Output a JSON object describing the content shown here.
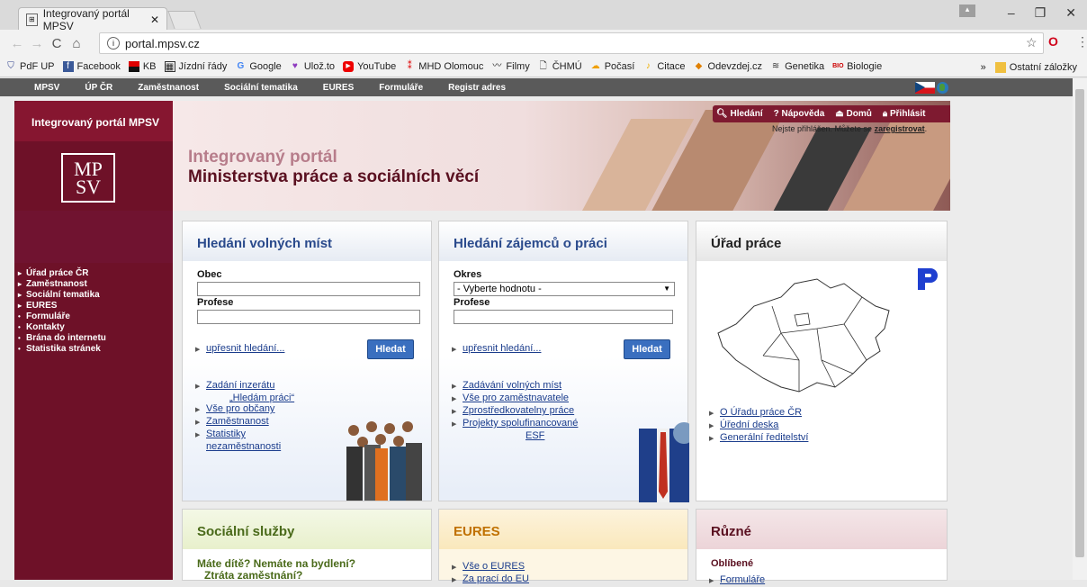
{
  "browser": {
    "tab_title": "Integrovaný portál MPSV",
    "url": "portal.mpsv.cz",
    "bookmarks": [
      "PdF UP",
      "Facebook",
      "KB",
      "Jízdní řády",
      "Google",
      "Ulož.to",
      "YouTube",
      "MHD Olomouc",
      "Filmy",
      "ČHMÚ",
      "Počasí",
      "Citace",
      "Odevzdej.cz",
      "Genetika",
      "Biologie"
    ],
    "other_bookmarks": "Ostatní záložky",
    "chevron": "»"
  },
  "topnav": [
    "MPSV",
    "ÚP ČR",
    "Zaměstnanost",
    "Sociální tematika",
    "EURES",
    "Formuláře",
    "Registr adres"
  ],
  "left": {
    "title": "Integrovaný portál MPSV",
    "logo_top": "MP",
    "logo_bottom": "SV",
    "nav": [
      {
        "bullet": "▸",
        "label": "Úřad práce ČR"
      },
      {
        "bullet": "▸",
        "label": "Zaměstnanost"
      },
      {
        "bullet": "▸",
        "label": "Sociální tematika"
      },
      {
        "bullet": "▸",
        "label": "EURES"
      },
      {
        "bullet": "•",
        "label": "Formuláře"
      },
      {
        "bullet": "•",
        "label": "Kontakty"
      },
      {
        "bullet": "•",
        "label": "Brána do internetu"
      },
      {
        "bullet": "•",
        "label": "Statistika stránek"
      }
    ]
  },
  "banner": {
    "line1": "Integrovaný portál",
    "line2": "Ministerstva práce a sociálních věcí",
    "util": [
      "Hledání",
      "Nápověda",
      "Domů",
      "Přihlásit"
    ],
    "login_msg": "Nejste přihlášen. Můžete se",
    "register": "zaregistrovat"
  },
  "box1": {
    "title": "Hledání volných míst",
    "obec": "Obec",
    "profese": "Profese",
    "refine": "upřesnit hledání...",
    "search": "Hledat",
    "links": [
      "Zadání inzerátu",
      "„Hledám práci“",
      "Vše pro občany",
      "Zaměstnanost",
      "Statistiky",
      "nezaměstnanosti"
    ]
  },
  "box2": {
    "title": "Hledání zájemců o práci",
    "okres": "Okres",
    "select_value": "- Vyberte hodnotu -",
    "profese": "Profese",
    "refine": "upřesnit hledání...",
    "search": "Hledat",
    "links": [
      "Zadávání volných míst",
      "Vše pro zaměstnavatele",
      "Zprostředkovatelny práce",
      "Projekty spolufinancované",
      "ESF"
    ]
  },
  "box3": {
    "title": "Úřad práce",
    "links": [
      "O Úřadu práce ČR",
      "Úřední deska",
      "Generální ředitelství"
    ]
  },
  "box4": {
    "title": "Sociální služby",
    "text1": "Máte dítě? Nemáte na bydlení?",
    "text2": "Ztráta zaměstnání?"
  },
  "box5": {
    "title": "EURES",
    "links": [
      "Vše o EURES",
      "Za prací do EU"
    ]
  },
  "box6": {
    "title": "Různé",
    "sub": "Oblíbené",
    "links": [
      "Formuláře"
    ]
  }
}
